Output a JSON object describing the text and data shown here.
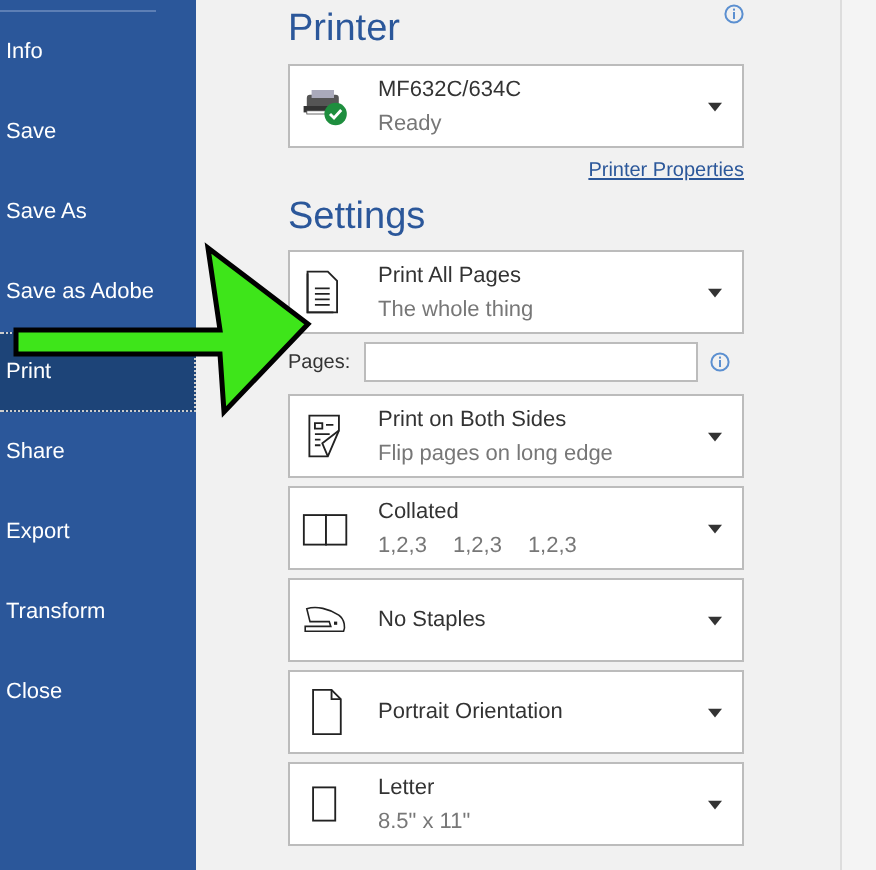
{
  "sidebar": {
    "items": [
      {
        "label": "Info",
        "selected": false
      },
      {
        "label": "Save",
        "selected": false
      },
      {
        "label": "Save As",
        "selected": false
      },
      {
        "label": "Save as Adobe",
        "selected": false
      },
      {
        "label": "Print",
        "selected": true
      },
      {
        "label": "Share",
        "selected": false
      },
      {
        "label": "Export",
        "selected": false
      },
      {
        "label": "Transform",
        "selected": false
      },
      {
        "label": "Close",
        "selected": false
      }
    ]
  },
  "printer": {
    "heading": "Printer",
    "name": "MF632C/634C",
    "status": "Ready",
    "properties_link": "Printer Properties"
  },
  "settings": {
    "heading": "Settings",
    "first": {
      "title": "Print All Pages",
      "subtitle": "The whole thing"
    },
    "pages": {
      "label": "Pages:"
    },
    "options": [
      {
        "title": "Print on Both Sides",
        "subtitle": [
          "Flip pages on long edge"
        ]
      },
      {
        "title": "Collated",
        "subtitle": [
          "1,2,3",
          "1,2,3",
          "1,2,3"
        ]
      },
      {
        "title": "No Staples"
      },
      {
        "title": "Portrait Orientation"
      },
      {
        "title": "Letter",
        "subtitle": [
          "8.5\" x 11\""
        ]
      }
    ]
  }
}
